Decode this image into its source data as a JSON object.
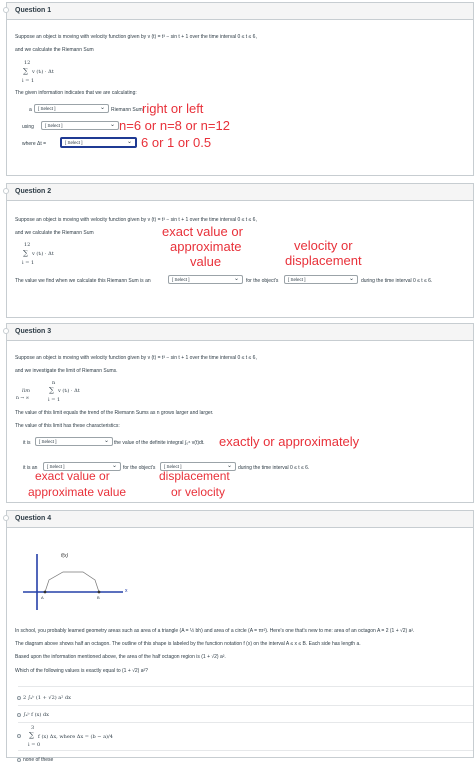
{
  "q1": {
    "title": "Question 1",
    "intro": "Suppose an object is moving with velocity function given by v (t) = t³ − sin t + 1 over the time interval 0 ≤ t ≤ 6,",
    "intro2": "and we calculate the Riemann Sum",
    "sum_top": "12",
    "sum_sigma": "∑",
    "sum_expr": "v (tᵢ) · Δt",
    "sum_bottom": "i = 1",
    "given": "The given information indicates that we are calculating:",
    "a_label": "a",
    "sel_a": "[ Select ]",
    "riemann_label": "Riemann Sum",
    "using_label": "using",
    "sel_using": "[ Select ]",
    "where_label": "where Δt =",
    "sel_where": "[ Select ]",
    "anno1": "right or left",
    "anno2": "n=6 or n=8 or n=12",
    "anno3": "6 or 1 or 0.5"
  },
  "q2": {
    "title": "Question 2",
    "intro": "Suppose an object is moving with velocity function given by v (t) = t³ − sin t + 1 over the time interval 0 ≤ t ≤ 6,",
    "intro2": "and we calculate the Riemann Sum",
    "sum_top": "12",
    "sum_sigma": "∑",
    "sum_expr": "v (tᵢ) · Δt",
    "sum_bottom": "i = 1",
    "find_text": "The value we find when we calculate this Riemann Sum is an",
    "sel_value": "[ Select ]",
    "for_text": "for the object's",
    "sel_object": "[ Select ]",
    "during_text": "during the time interval 0 ≤ t ≤ 6.",
    "anno1a": "exact value or",
    "anno1b": "approximate",
    "anno1c": "value",
    "anno2a": "velocity or",
    "anno2b": "displacement"
  },
  "q3": {
    "title": "Question 3",
    "intro": "Suppose an object is moving with velocity function given by v (t) = t³ − sin t + 1 over the time interval 0 ≤ t ≤ 6,",
    "intro2": "and we investigate the limit of Riemann Sums.",
    "lim": "lim",
    "lim_sub": "n → ∞",
    "sum_top": "n",
    "sum_sigma": "∑",
    "sum_expr": "v (tᵢ) · Δt",
    "sum_bottom": "i = 1",
    "trend": "The value of this limit equals the trend of the Riemann Sums as n grows larger and larger.",
    "chars": "The value of this limit has these characteristics:",
    "it_is": "it is",
    "sel_is": "[ Select ]",
    "integral_text": "the value of the definite integral ∫₀⁶ v(t)dt.",
    "it_is_an": "it is an",
    "sel_an": "[ Select ]",
    "for_text": "for the object's",
    "sel_obj": "[ Select ]",
    "during_text": "during the time interval 0 ≤ t ≤ 6.",
    "anno1": "exactly or approximately",
    "anno2a": "exact value or",
    "anno2b": "approximate value",
    "anno3a": "displacement",
    "anno3b": "or velocity"
  },
  "q4": {
    "title": "Question 4",
    "graph_fx": "f(x)",
    "graph_A": "A",
    "graph_B": "B",
    "graph_x": "x",
    "graph_y": "y",
    "p1": "In school, you probably learned geometry areas such as area of a triangle (A = ½ bh) and area of a circle (A = πr²). Here's one that's new to me: area of an octagon A = 2 (1 + √2) a².",
    "p2": "The diagram above shows half an octagon. The outline of this shape is labeled by the function notation f (x) on the interval A ≤ x ≤ B. Each side has length a.",
    "p3": "Based upon the information mentioned above, the area of the half octagon region is (1 + √2) a².",
    "question": "Which of the following values is exactly equal to (1 + √2) a²?",
    "opt1": "2 ∫ₐᵇ (1 + √2) a² dx",
    "opt2": "∫ₐᵇ f (x) dx",
    "opt3_top": "3",
    "opt3_sigma": "∑",
    "opt3_expr": "f (x) Δx, where Δx = (b − a)/4",
    "opt3_bottom": "i = 0",
    "opt4": "none of these"
  },
  "colors": {
    "annotation": "#e8313a",
    "active_select": "#1f3a93",
    "border": "#c7cdd1",
    "header_bg": "#f5f5f5"
  },
  "icons": {
    "select_chevron": "chevron-down-icon"
  }
}
